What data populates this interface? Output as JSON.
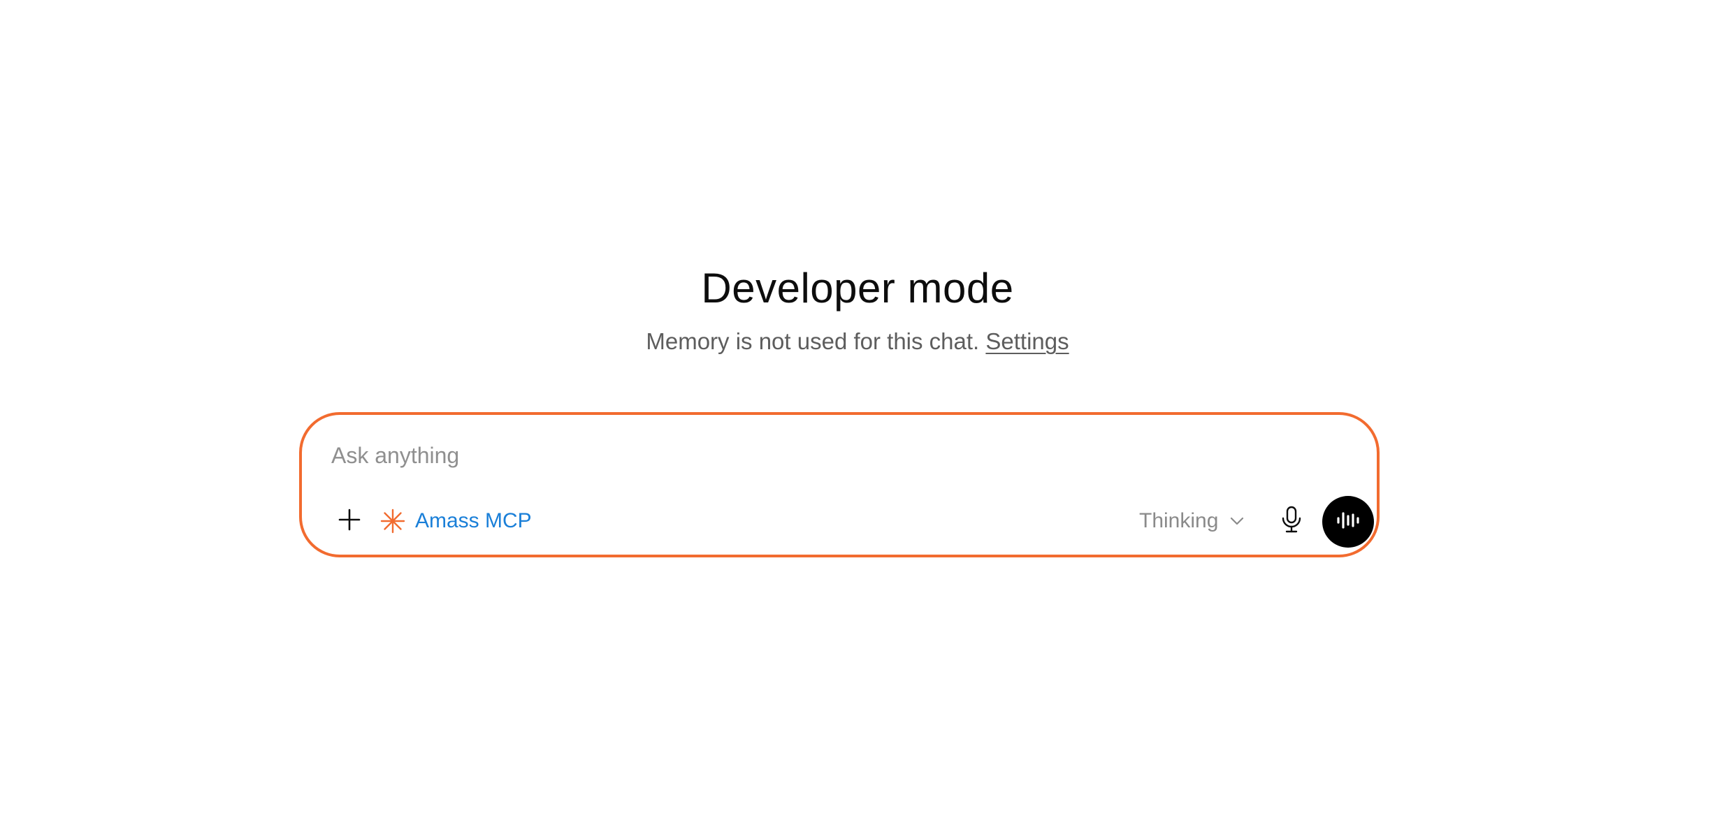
{
  "header": {
    "title": "Developer mode",
    "subtitle_text": "Memory is not used for this chat.",
    "settings_link": "Settings"
  },
  "composer": {
    "placeholder": "Ask anything",
    "value": "",
    "tool_chip_label": "Amass MCP",
    "model_label": "Thinking",
    "icons": {
      "plus": "plus-icon",
      "tool": "asterisk-spark-icon",
      "chevron": "chevron-down-icon",
      "mic": "microphone-icon",
      "voice": "voice-waveform-icon"
    }
  },
  "colors": {
    "accent_border": "#f26b2f",
    "tool_chip_text": "#1a7fd8",
    "voice_button_bg": "#000000"
  }
}
